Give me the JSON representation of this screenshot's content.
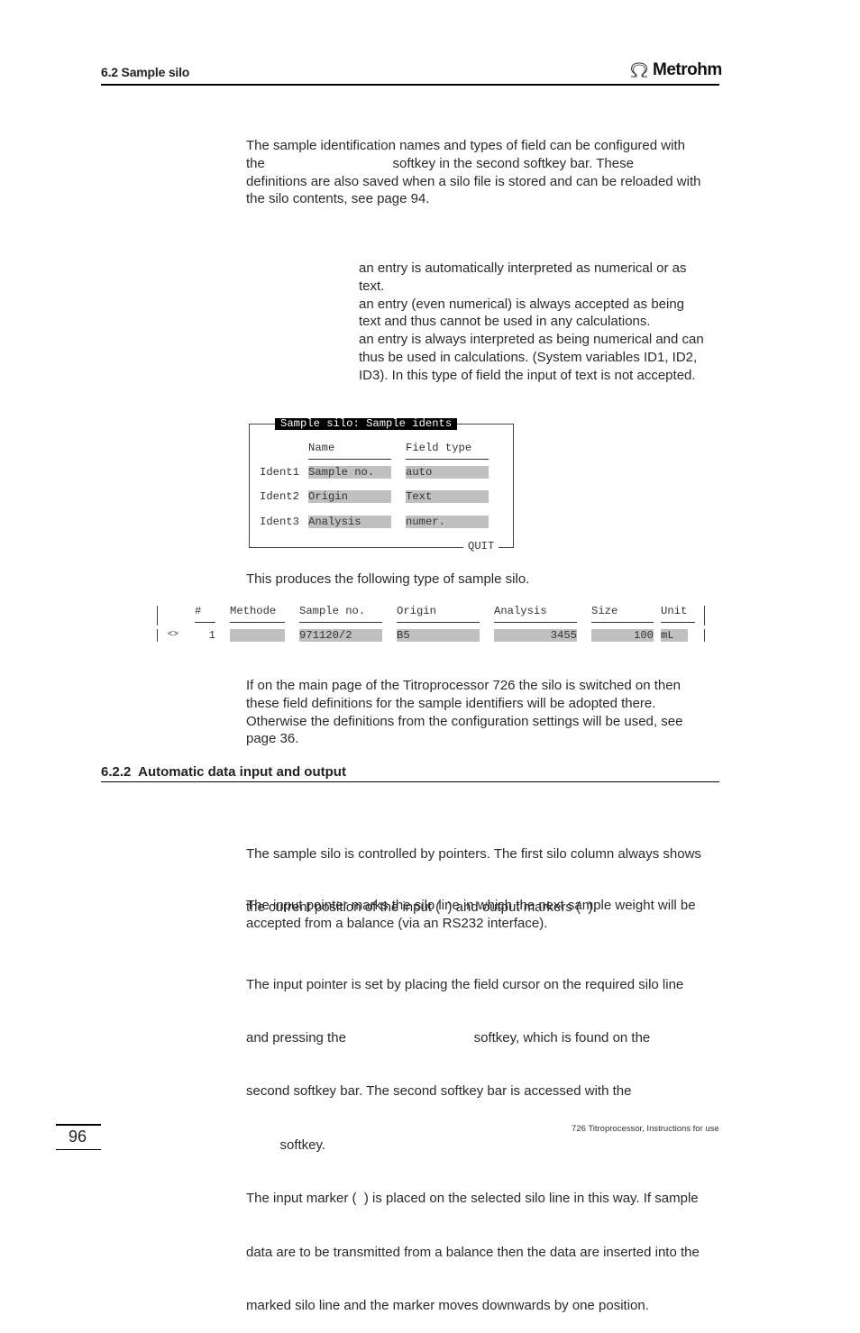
{
  "header": {
    "section_title": "6.2 Sample silo",
    "logo_text": "Metrohm",
    "logo_icon": "omega-icon"
  },
  "intro": {
    "lines": [
      "The sample identification names and types of field can be configured with",
      "the                                  softkey in the second softkey bar. These",
      "definitions are also saved when a silo file is stored and can be reloaded with",
      "the silo contents, see page 94."
    ]
  },
  "field_types": {
    "lines": [
      "an entry is automatically interpreted as numerical or as",
      "text.",
      "an entry (even numerical) is always accepted as being",
      "text and thus cannot be used in any calculations.",
      "an entry is always interpreted as being numerical and can",
      "thus be used in calculations. (System variables ID1, ID2,",
      "ID3). In this type of field the input of text is not accepted."
    ]
  },
  "dialog": {
    "title": "Sample silo: Sample idents",
    "col_name": "Name",
    "col_type": "Field type",
    "rows": [
      {
        "label": "Ident1",
        "name": "Sample no.",
        "type": "auto"
      },
      {
        "label": "Ident2",
        "name": "Origin",
        "type": "Text"
      },
      {
        "label": "Ident3",
        "name": "Analysis",
        "type": "numer."
      }
    ],
    "quit_label": "QUIT"
  },
  "produces_text": "This produces the following type of sample silo.",
  "silo_table": {
    "headers": [
      "#",
      "Methode",
      "Sample no.",
      "Origin",
      "Analysis",
      "Size",
      "Unit"
    ],
    "row": {
      "marker": "<>",
      "number": "1",
      "methode": "",
      "sample_no": "971120/2",
      "origin": "B5",
      "analysis": "3455",
      "size": "100",
      "unit": "mL"
    }
  },
  "main_page": {
    "lines": [
      "If on the main page of the Titroprocessor 726 the silo is switched on then",
      "these field definitions for the sample identifiers will be adopted there.",
      "Otherwise the definitions from the configuration settings will be used, see",
      "page 36."
    ]
  },
  "section_622": {
    "title": "6.2.2  Automatic data input and output",
    "pointers": [
      "The sample silo is controlled by pointers. The first silo column always shows",
      "the current position of the input (  ) and output markers (  )."
    ],
    "input_pointer": [
      "The input pointer marks the silo line in which the next sample weight will be",
      "accepted from a balance (via an RS232 interface)."
    ],
    "set_pointer": [
      "The input pointer is set by placing the field cursor on the required silo line",
      "and pressing the                                  softkey, which is found on the",
      "second softkey bar. The second softkey bar is accessed with the",
      "         softkey.",
      "The input marker (  ) is placed on the selected silo line in this way. If sample",
      "data are to be transmitted from a balance then the data are inserted into the",
      "marked silo line and the marker moves downwards by one position."
    ]
  },
  "footer": {
    "page_number": "96",
    "doc_title": "726 Titroprocessor, Instructions for use"
  }
}
